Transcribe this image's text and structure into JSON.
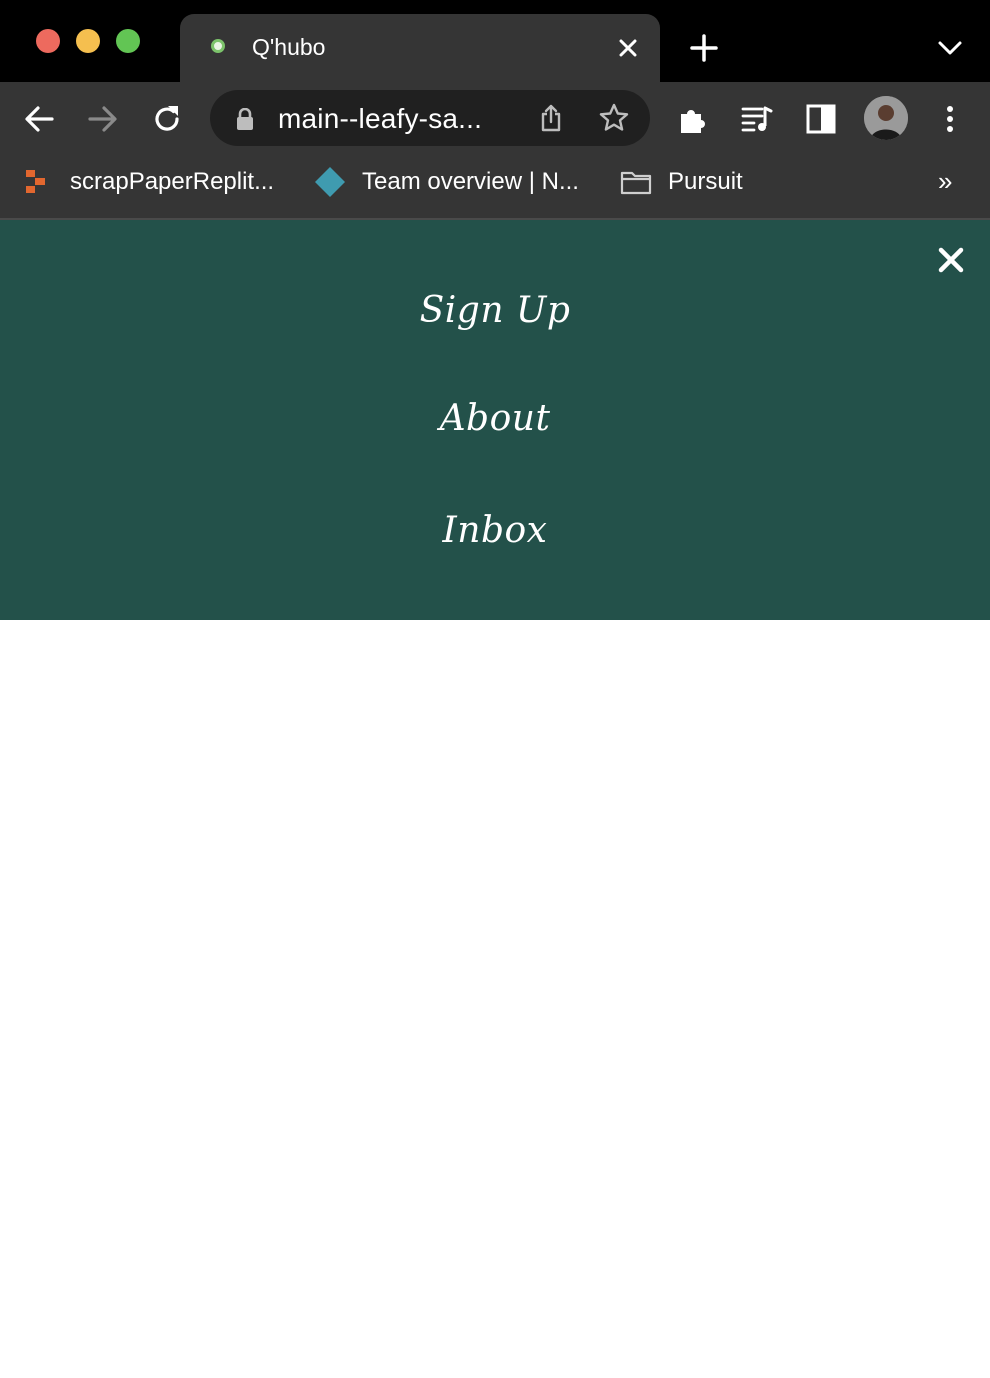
{
  "tab": {
    "title": "Q'hubo"
  },
  "omnibox": {
    "url": "main--leafy-sa..."
  },
  "bookmarks": [
    {
      "label": "scrapPaperReplit...",
      "icon": "replit-icon"
    },
    {
      "label": "Team overview | N...",
      "icon": "diamond-icon"
    },
    {
      "label": "Pursuit",
      "icon": "folder-icon"
    }
  ],
  "nav": {
    "links": [
      {
        "label": "Sign Up"
      },
      {
        "label": "About"
      },
      {
        "label": "Inbox"
      }
    ]
  },
  "colors": {
    "nav_background": "#23514a",
    "chrome_dark": "#353535",
    "omnibox_bg": "#202020"
  }
}
